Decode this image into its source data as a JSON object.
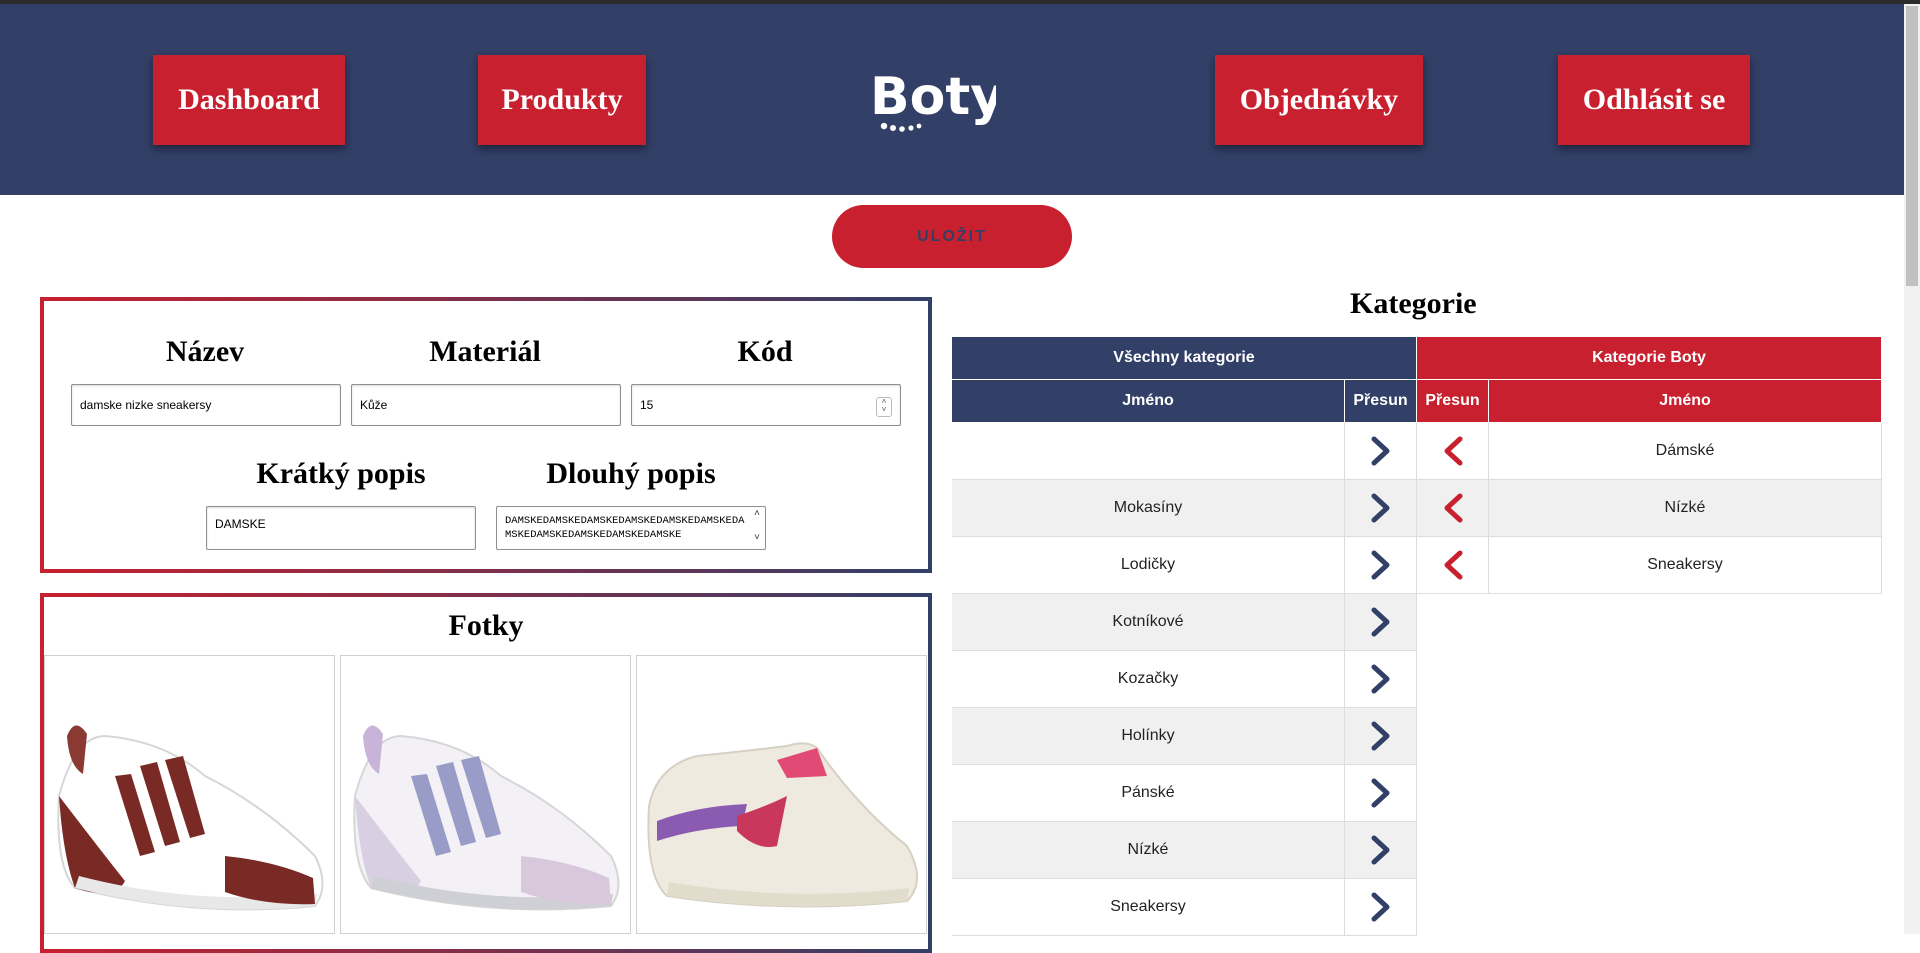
{
  "nav": {
    "dashboard": "Dashboard",
    "produkty": "Produkty",
    "objednavky": "Objednávky",
    "odhlasit": "Odhlásit se"
  },
  "logo_text": "Boty",
  "save_label": "ULOŽIT",
  "form": {
    "nazev_label": "Název",
    "nazev_value": "damske nizke sneakersy",
    "material_label": "Materiál",
    "material_value": "Kůže",
    "kod_label": "Kód",
    "kod_value": "15",
    "kratky_label": "Krátký popis",
    "kratky_value": "DAMSKE",
    "dlouhy_label": "Dlouhý popis",
    "dlouhy_value": "DAMSKEDAMSKEDAMSKEDAMSKEDAMSKEDAMSKEDAMSKEDAMSKEDAMSKEDAMSKEDAMSKE"
  },
  "photos_title": "Fotky",
  "categories": {
    "title": "Kategorie",
    "all_header": "Všechny kategorie",
    "boty_header": "Kategorie Boty",
    "col_name": "Jméno",
    "col_move": "Přesun",
    "all": [
      "",
      "Mokasíny",
      "Lodičky",
      "Kotníkové",
      "Kozačky",
      "Holínky",
      "Pánské",
      "Nízké",
      "Sneakersy"
    ],
    "boty": [
      "Dámské",
      "Nízké",
      "Sneakersy"
    ]
  },
  "colors": {
    "navy": "#323f67",
    "red": "#c8202f",
    "row_alt": "#f0f0f0"
  }
}
